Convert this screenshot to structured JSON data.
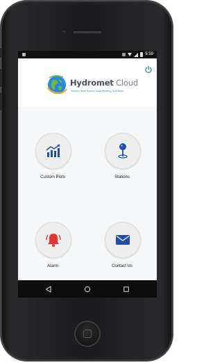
{
  "status_bar": {
    "time": "5:59",
    "icons": [
      "notification-icon",
      "no-sim-icon",
      "wifi-icon",
      "signal-icon",
      "battery-icon"
    ]
  },
  "header": {
    "logo_title_main": "Hydromet",
    "logo_title_accent": " Cloud",
    "logo_tagline": "Secure Web Based Data Hosting Solutions",
    "power_icon": "power-icon"
  },
  "menu": {
    "items": [
      {
        "label": "Custom Plots",
        "icon": "bar-chart-trend-icon",
        "color": "#1f4fa8"
      },
      {
        "label": "Stations",
        "icon": "map-pin-icon",
        "color": "#1f4fa8"
      },
      {
        "label": "Alarm",
        "icon": "bell-icon",
        "color": "#e63333"
      },
      {
        "label": "Contact Us",
        "icon": "envelope-icon",
        "color": "#1f4fa8"
      }
    ]
  },
  "nav_bar": {
    "icons": [
      "back-icon",
      "home-icon",
      "recents-icon"
    ]
  },
  "colors": {
    "accent": "#1f4fa8",
    "alarm": "#e63333",
    "tagline": "#3a8fc9"
  }
}
